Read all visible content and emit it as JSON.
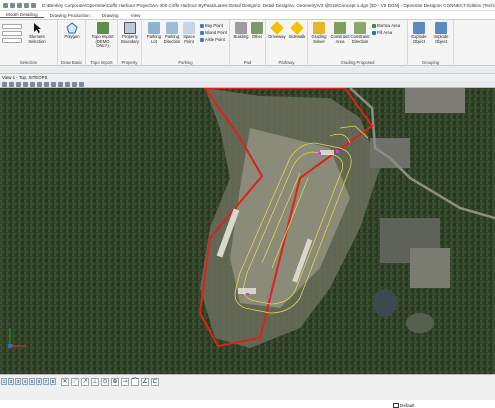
{
  "titlebar": {
    "path": "D:\\Bentley Corporate\\OpenSite\\Coffs Harbour Project\\AA-300 Coffs Harbour ByPass\\Latest Detail Design\\2. Detail Design\\a. Geometry\\V3 @018\\Concept 1.dgn [3D - V8 DGN] - OpenSite Designer CONNECT Edition (Technol..."
  },
  "tabs": [
    "Model Detailing",
    "Drawing Production",
    "Drawing",
    "View"
  ],
  "ribbon": {
    "selection": {
      "element_selection": "Element Selection",
      "label": "Selection"
    },
    "draw_basic": {
      "polygon": "Polygon",
      "label": "Draw Basic"
    },
    "topo_import": {
      "button": "Topo Import (DEMO ONLY)",
      "label": "Topo Import"
    },
    "property": {
      "button": "Property Boundary",
      "label": "Property"
    },
    "parking": {
      "lot": "Parking Lot",
      "direction": "Parking Direction",
      "space": "Space Point",
      "bay_point": "Bay Point",
      "island_point": "Island Point",
      "aisle_point": "Aisle Point",
      "label": "Parking"
    },
    "pad": {
      "building": "Building",
      "other": "Other",
      "label": "Pad"
    },
    "pathway": {
      "driveway": "Driveway",
      "sidewalk": "Sidewalk",
      "label": "Pathway"
    },
    "grading": {
      "solver": "Grading Solver",
      "constraint": "Constraint Area",
      "direction": "Constraint Direction",
      "borrow": "Borrow Area",
      "fill": "Fill Area",
      "label": "Grading Proposed"
    },
    "grouping": {
      "explode": "Explode Object",
      "implode": "Implode Object",
      "label": "Grouping"
    }
  },
  "view": {
    "title": "View 1 - Top, SITEOPS"
  },
  "statusbar": {
    "view_numbers": [
      "1",
      "2",
      "3",
      "4",
      "5",
      "6",
      "7",
      "8"
    ],
    "level": "Default"
  },
  "colors": {
    "boundary": "#e0201a",
    "design": "#e2d64a",
    "accent": "#1d6fb8"
  }
}
